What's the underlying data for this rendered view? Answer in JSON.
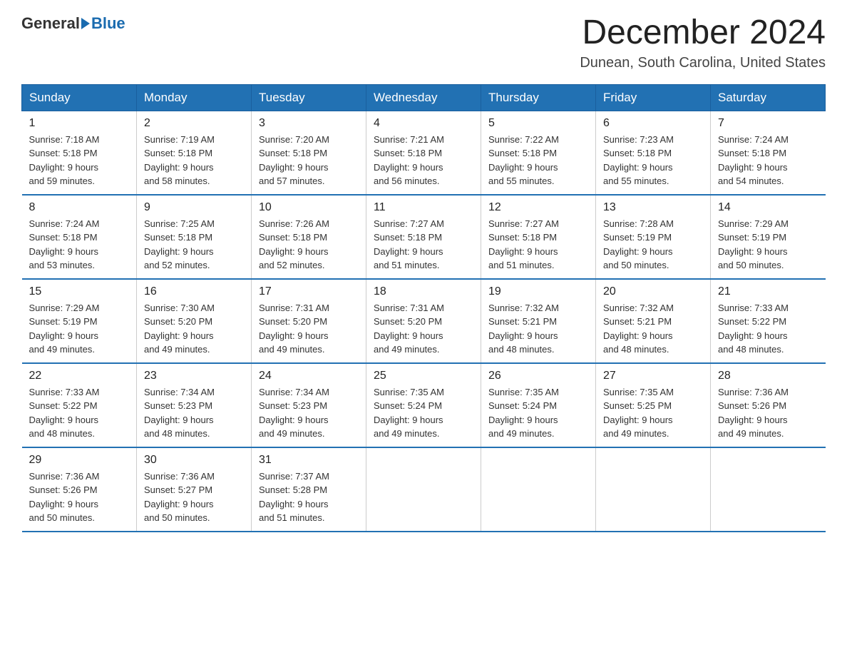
{
  "header": {
    "logo_general": "General",
    "logo_blue": "Blue",
    "month_title": "December 2024",
    "location": "Dunean, South Carolina, United States"
  },
  "weekdays": [
    "Sunday",
    "Monday",
    "Tuesday",
    "Wednesday",
    "Thursday",
    "Friday",
    "Saturday"
  ],
  "weeks": [
    [
      {
        "day": "1",
        "sunrise": "7:18 AM",
        "sunset": "5:18 PM",
        "daylight": "9 hours and 59 minutes."
      },
      {
        "day": "2",
        "sunrise": "7:19 AM",
        "sunset": "5:18 PM",
        "daylight": "9 hours and 58 minutes."
      },
      {
        "day": "3",
        "sunrise": "7:20 AM",
        "sunset": "5:18 PM",
        "daylight": "9 hours and 57 minutes."
      },
      {
        "day": "4",
        "sunrise": "7:21 AM",
        "sunset": "5:18 PM",
        "daylight": "9 hours and 56 minutes."
      },
      {
        "day": "5",
        "sunrise": "7:22 AM",
        "sunset": "5:18 PM",
        "daylight": "9 hours and 55 minutes."
      },
      {
        "day": "6",
        "sunrise": "7:23 AM",
        "sunset": "5:18 PM",
        "daylight": "9 hours and 55 minutes."
      },
      {
        "day": "7",
        "sunrise": "7:24 AM",
        "sunset": "5:18 PM",
        "daylight": "9 hours and 54 minutes."
      }
    ],
    [
      {
        "day": "8",
        "sunrise": "7:24 AM",
        "sunset": "5:18 PM",
        "daylight": "9 hours and 53 minutes."
      },
      {
        "day": "9",
        "sunrise": "7:25 AM",
        "sunset": "5:18 PM",
        "daylight": "9 hours and 52 minutes."
      },
      {
        "day": "10",
        "sunrise": "7:26 AM",
        "sunset": "5:18 PM",
        "daylight": "9 hours and 52 minutes."
      },
      {
        "day": "11",
        "sunrise": "7:27 AM",
        "sunset": "5:18 PM",
        "daylight": "9 hours and 51 minutes."
      },
      {
        "day": "12",
        "sunrise": "7:27 AM",
        "sunset": "5:18 PM",
        "daylight": "9 hours and 51 minutes."
      },
      {
        "day": "13",
        "sunrise": "7:28 AM",
        "sunset": "5:19 PM",
        "daylight": "9 hours and 50 minutes."
      },
      {
        "day": "14",
        "sunrise": "7:29 AM",
        "sunset": "5:19 PM",
        "daylight": "9 hours and 50 minutes."
      }
    ],
    [
      {
        "day": "15",
        "sunrise": "7:29 AM",
        "sunset": "5:19 PM",
        "daylight": "9 hours and 49 minutes."
      },
      {
        "day": "16",
        "sunrise": "7:30 AM",
        "sunset": "5:20 PM",
        "daylight": "9 hours and 49 minutes."
      },
      {
        "day": "17",
        "sunrise": "7:31 AM",
        "sunset": "5:20 PM",
        "daylight": "9 hours and 49 minutes."
      },
      {
        "day": "18",
        "sunrise": "7:31 AM",
        "sunset": "5:20 PM",
        "daylight": "9 hours and 49 minutes."
      },
      {
        "day": "19",
        "sunrise": "7:32 AM",
        "sunset": "5:21 PM",
        "daylight": "9 hours and 48 minutes."
      },
      {
        "day": "20",
        "sunrise": "7:32 AM",
        "sunset": "5:21 PM",
        "daylight": "9 hours and 48 minutes."
      },
      {
        "day": "21",
        "sunrise": "7:33 AM",
        "sunset": "5:22 PM",
        "daylight": "9 hours and 48 minutes."
      }
    ],
    [
      {
        "day": "22",
        "sunrise": "7:33 AM",
        "sunset": "5:22 PM",
        "daylight": "9 hours and 48 minutes."
      },
      {
        "day": "23",
        "sunrise": "7:34 AM",
        "sunset": "5:23 PM",
        "daylight": "9 hours and 48 minutes."
      },
      {
        "day": "24",
        "sunrise": "7:34 AM",
        "sunset": "5:23 PM",
        "daylight": "9 hours and 49 minutes."
      },
      {
        "day": "25",
        "sunrise": "7:35 AM",
        "sunset": "5:24 PM",
        "daylight": "9 hours and 49 minutes."
      },
      {
        "day": "26",
        "sunrise": "7:35 AM",
        "sunset": "5:24 PM",
        "daylight": "9 hours and 49 minutes."
      },
      {
        "day": "27",
        "sunrise": "7:35 AM",
        "sunset": "5:25 PM",
        "daylight": "9 hours and 49 minutes."
      },
      {
        "day": "28",
        "sunrise": "7:36 AM",
        "sunset": "5:26 PM",
        "daylight": "9 hours and 49 minutes."
      }
    ],
    [
      {
        "day": "29",
        "sunrise": "7:36 AM",
        "sunset": "5:26 PM",
        "daylight": "9 hours and 50 minutes."
      },
      {
        "day": "30",
        "sunrise": "7:36 AM",
        "sunset": "5:27 PM",
        "daylight": "9 hours and 50 minutes."
      },
      {
        "day": "31",
        "sunrise": "7:37 AM",
        "sunset": "5:28 PM",
        "daylight": "9 hours and 51 minutes."
      },
      null,
      null,
      null,
      null
    ]
  ]
}
